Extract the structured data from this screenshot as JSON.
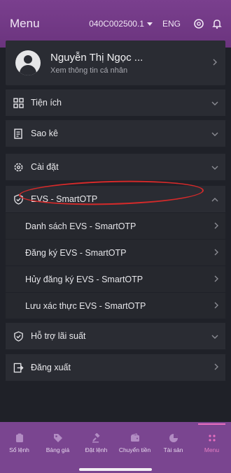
{
  "header": {
    "title": "Menu",
    "account": "040C002500.1",
    "language": "ENG",
    "icons": [
      "settings-icon",
      "bell-icon"
    ]
  },
  "profile": {
    "name": "Nguyễn Thị Ngọc ...",
    "subtitle": "Xem thông tin cá nhân"
  },
  "menu": {
    "utilities": "Tiện ích",
    "statements": "Sao kê",
    "settings": "Cài đặt",
    "evs": "EVS - SmartOTP",
    "evs_list": "Danh sách EVS - SmartOTP",
    "evs_register": "Đăng ký EVS - SmartOTP",
    "evs_cancel": "Hủy đăng ký EVS - SmartOTP",
    "evs_save": "Lưu xác thực EVS - SmartOTP",
    "interest_support": "Hỗ trợ lãi suất",
    "logout": "Đăng xuất"
  },
  "tabs": {
    "orders": "Sổ lệnh",
    "price_board": "Bảng giá",
    "place_order": "Đặt lệnh",
    "transfer": "Chuyển tiền",
    "assets": "Tài sản",
    "menu": "Menu"
  },
  "colors": {
    "header": "#7a3f8e",
    "background": "#1f2128",
    "panel": "#2a2c33",
    "highlight_ring": "#d52a2a",
    "active_tab": "#e96fc0"
  }
}
